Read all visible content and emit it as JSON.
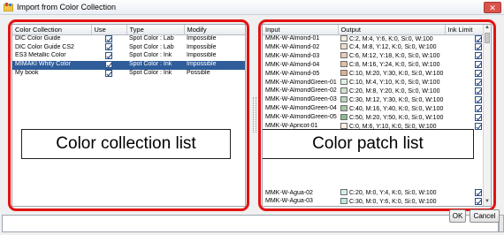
{
  "window": {
    "title": "Import from Color Collection",
    "close_label": "✕"
  },
  "collections": {
    "columns": [
      "Color Collection",
      "Use",
      "Type",
      "Modify"
    ],
    "rows": [
      {
        "name": "DIC Color Guide",
        "use": true,
        "type": "Spot Color : Lab",
        "modify": "Impossible",
        "selected": false
      },
      {
        "name": "DIC Color Guide CS2",
        "use": true,
        "type": "Spot Color : Lab",
        "modify": "Impossible",
        "selected": false
      },
      {
        "name": "ES3 Metallic Color",
        "use": true,
        "type": "Spot Color : Ink",
        "modify": "Impossible",
        "selected": false
      },
      {
        "name": "MIMAKI Whity Color",
        "use": true,
        "type": "Spot Color : Ink",
        "modify": "Impossible",
        "selected": true
      },
      {
        "name": "My book",
        "use": true,
        "type": "Spot Color : Ink",
        "modify": "Possible",
        "selected": false
      }
    ],
    "callout_label": "Color collection list"
  },
  "patches": {
    "columns": [
      "Input",
      "Output",
      "Ink Limit"
    ],
    "rows_top": [
      {
        "input": "MMK-W-Almond-01",
        "output": "C:2, M:4, Y:6, K:0, Si:0, W:100",
        "swatch": "#f4ebe2"
      },
      {
        "input": "MMK-W-Almond-02",
        "output": "C:4, M:8, Y:12, K:0, Si:0, W:100",
        "swatch": "#eedcce"
      },
      {
        "input": "MMK-W-Almond-03",
        "output": "C:6, M:12, Y:18, K:0, Si:0, W:100",
        "swatch": "#e7cdb9"
      },
      {
        "input": "MMK-W-Almond-04",
        "output": "C:8, M:16, Y:24, K:0, Si:0, W:100",
        "swatch": "#e0bfa5"
      },
      {
        "input": "MMK-W-Almond-05",
        "output": "C:10, M:20, Y:30, K:0, Si:0, W:100",
        "swatch": "#dab193"
      },
      {
        "input": "MMK-W-AlmondGreen-01",
        "output": "C:10, M:4, Y:10, K:0, Si:0, W:100",
        "swatch": "#e4efe4"
      },
      {
        "input": "MMK-W-AlmondGreen-02",
        "output": "C:20, M:8, Y:20, K:0, Si:0, W:100",
        "swatch": "#cfe2cf"
      },
      {
        "input": "MMK-W-AlmondGreen-03",
        "output": "C:30, M:12, Y:30, K:0, Si:0, W:100",
        "swatch": "#b9d4ba"
      },
      {
        "input": "MMK-W-AlmondGreen-04",
        "output": "C:40, M:16, Y:40, K:0, Si:0, W:100",
        "swatch": "#a3c6a5"
      },
      {
        "input": "MMK-W-AlmondGreen-05",
        "output": "C:50, M:20, Y:50, K:0, Si:0, W:100",
        "swatch": "#8db990"
      },
      {
        "input": "MMK-W-Apricot-01",
        "output": "C:0, M:6, Y:10, K:0, Si:0, W:100",
        "swatch": "#fdf0e4"
      }
    ],
    "rows_bottom": [
      {
        "input": "MMK-W-Agua-02",
        "output": "C:20, M:0, Y:4, K:0, Si:0, W:100",
        "swatch": "#d3efec"
      },
      {
        "input": "MMK-W-Agua-03",
        "output": "C:30, M:0, Y:6, K:0, Si:0, W:100",
        "swatch": "#bde7e2"
      }
    ],
    "callout_label": "Color patch list"
  },
  "buttons": {
    "ok": "OK",
    "cancel": "Cancel"
  },
  "accent_color": "#e31212"
}
